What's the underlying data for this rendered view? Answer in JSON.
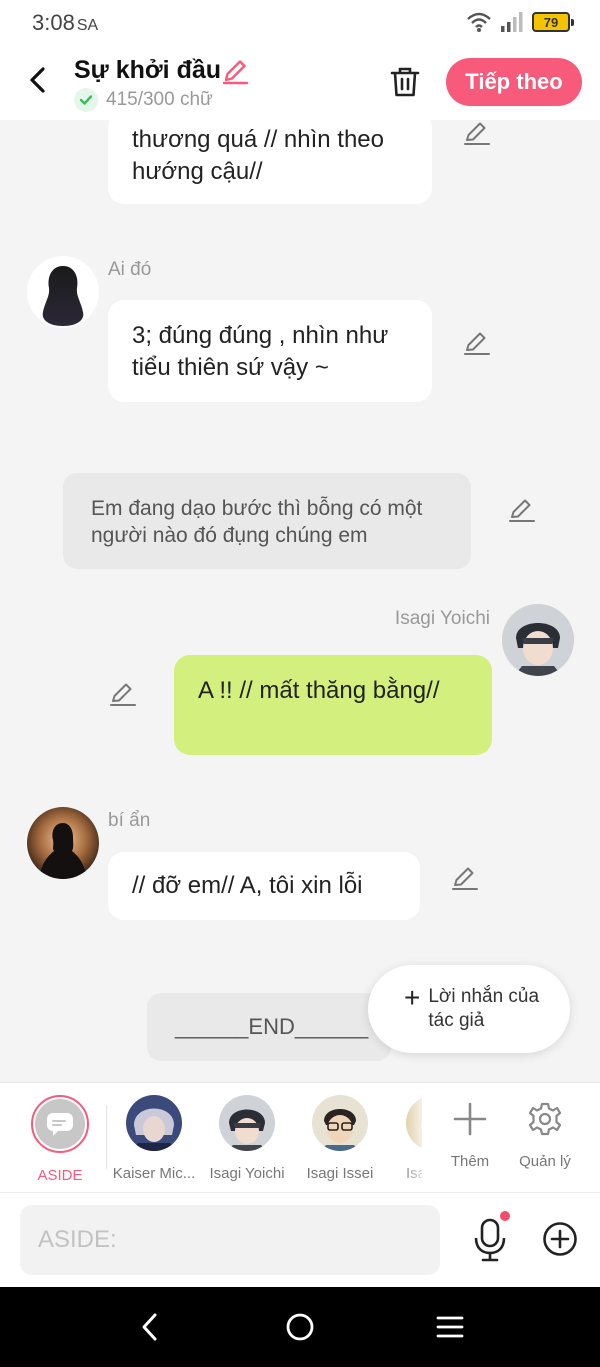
{
  "status_bar": {
    "time": "3:08",
    "period": "SA",
    "battery": "79"
  },
  "header": {
    "title": "Sự khởi đầu",
    "word_count": "415/300 chữ",
    "next_label": "Tiếp theo"
  },
  "messages": [
    {
      "kind": "left",
      "speaker": "",
      "text": "thương quá // nhìn theo hướng cậu//"
    },
    {
      "kind": "left",
      "speaker": "Ai đó",
      "text": "3; đúng đúng , nhìn như tiểu thiên sứ vậy ~"
    },
    {
      "kind": "narration",
      "text": "Em đang dạo bước thì bỗng có một người nào đó đụng chúng em"
    },
    {
      "kind": "right",
      "speaker": "Isagi Yoichi",
      "text": "A !! // mất thăng bằng//"
    },
    {
      "kind": "left",
      "speaker": "bí ẩn",
      "text": "// đỡ em// A, tôi xin lỗi"
    },
    {
      "kind": "end",
      "text": "______END______"
    }
  ],
  "author_note": {
    "label": "Lời nhắn của tác giả"
  },
  "characters": {
    "aside_label": "ASIDE",
    "items": [
      "Kaiser Mic...",
      "Isagi Yoichi",
      "Isagi Issei",
      "Isa"
    ],
    "add_label": "Thêm",
    "manage_label": "Quản lý"
  },
  "input": {
    "placeholder": "ASIDE:"
  },
  "colors": {
    "accent": "#f75a7a",
    "right_bubble": "#d3f07f",
    "background": "#f4f4f4"
  }
}
